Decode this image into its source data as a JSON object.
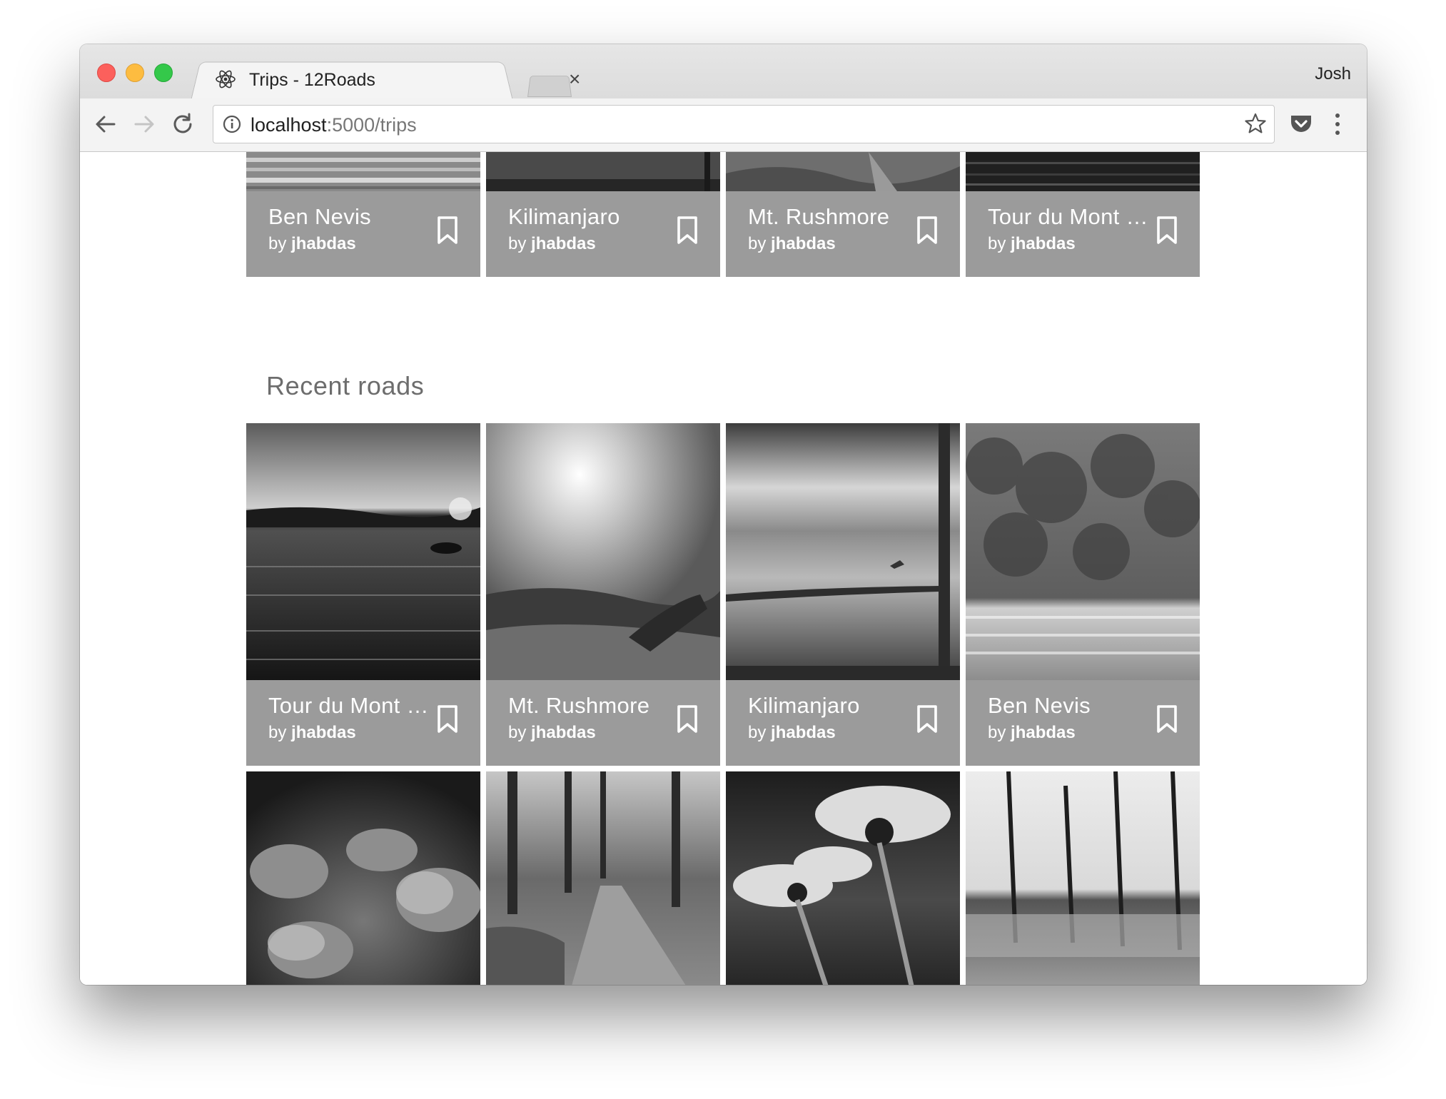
{
  "browser": {
    "tab_title": "Trips - 12Roads",
    "tab_close": "×",
    "profile_name": "Josh",
    "url_host": "localhost",
    "url_path": ":5000/trips",
    "icons": [
      "react-icon",
      "back-arrow-icon",
      "forward-arrow-icon",
      "reload-icon",
      "info-icon",
      "star-icon",
      "pocket-icon",
      "menu-icon",
      "bookmark-icon"
    ]
  },
  "top_row": [
    {
      "name": "Ben Nevis",
      "by_prefix": "by",
      "author": "jhabdas"
    },
    {
      "name": "Kilimanjaro",
      "by_prefix": "by",
      "author": "jhabdas"
    },
    {
      "name": "Mt. Rushmore",
      "by_prefix": "by",
      "author": "jhabdas"
    },
    {
      "name": "Tour du Mont Blanc",
      "by_prefix": "by",
      "author": "jhabdas"
    }
  ],
  "recent": {
    "title": "Recent roads",
    "row1": [
      {
        "name": "Tour du Mont Blanc",
        "by_prefix": "by",
        "author": "jhabdas"
      },
      {
        "name": "Mt. Rushmore",
        "by_prefix": "by",
        "author": "jhabdas"
      },
      {
        "name": "Kilimanjaro",
        "by_prefix": "by",
        "author": "jhabdas"
      },
      {
        "name": "Ben Nevis",
        "by_prefix": "by",
        "author": "jhabdas"
      }
    ]
  },
  "colors": {
    "card_bar": "#9b9b9b",
    "section_title": "#6d6d6d"
  }
}
